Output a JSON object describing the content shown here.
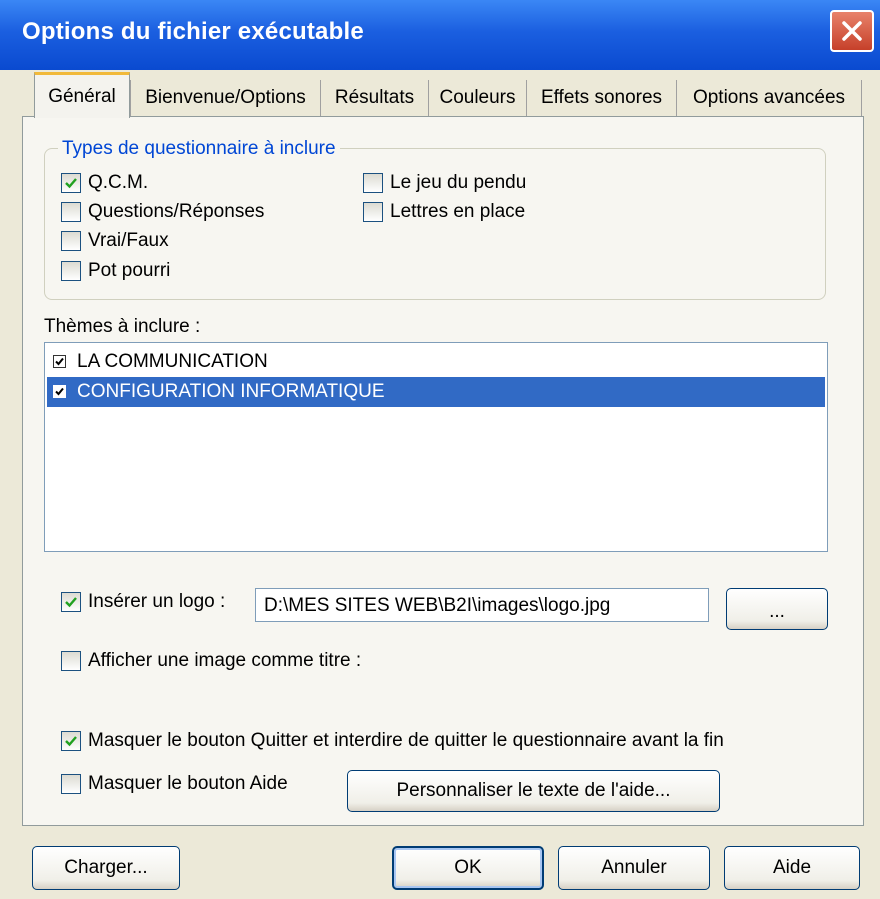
{
  "window": {
    "title": "Options du fichier exécutable"
  },
  "tabs": [
    "Général",
    "Bienvenue/Options",
    "Résultats",
    "Couleurs",
    "Effets sonores",
    "Options avancées"
  ],
  "types_group": {
    "legend": "Types de questionnaire à inclure",
    "options": [
      {
        "label": "Q.C.M.",
        "checked": true
      },
      {
        "label": "Questions/Réponses",
        "checked": false
      },
      {
        "label": "Vrai/Faux",
        "checked": false
      },
      {
        "label": "Pot pourri",
        "checked": false
      },
      {
        "label": "Le jeu du pendu",
        "checked": false
      },
      {
        "label": "Lettres en place",
        "checked": false
      }
    ]
  },
  "themes": {
    "label": "Thèmes à inclure :",
    "items": [
      {
        "label": "LA COMMUNICATION",
        "checked": true,
        "selected": false
      },
      {
        "label": "CONFIGURATION INFORMATIQUE",
        "checked": true,
        "selected": true
      }
    ]
  },
  "logo": {
    "label": "Insérer un logo :",
    "checked": true,
    "path": "D:\\MES SITES WEB\\B2I\\images\\logo.jpg",
    "browse_label": "..."
  },
  "title_image": {
    "label": "Afficher une image comme titre :",
    "checked": false
  },
  "hide_quit": {
    "label": "Masquer le bouton Quitter et interdire de quitter le questionnaire avant la fin",
    "checked": true
  },
  "hide_help": {
    "label": "Masquer le bouton Aide",
    "checked": false
  },
  "customize_help_label": "Personnaliser le texte de l'aide...",
  "footer": {
    "load": "Charger...",
    "ok": "OK",
    "cancel": "Annuler",
    "help": "Aide"
  },
  "colors": {
    "titlebar": "#0a4ad0",
    "dialog_bg": "#ece9d8",
    "selection": "#316ac5",
    "group_legend": "#0046d5"
  }
}
